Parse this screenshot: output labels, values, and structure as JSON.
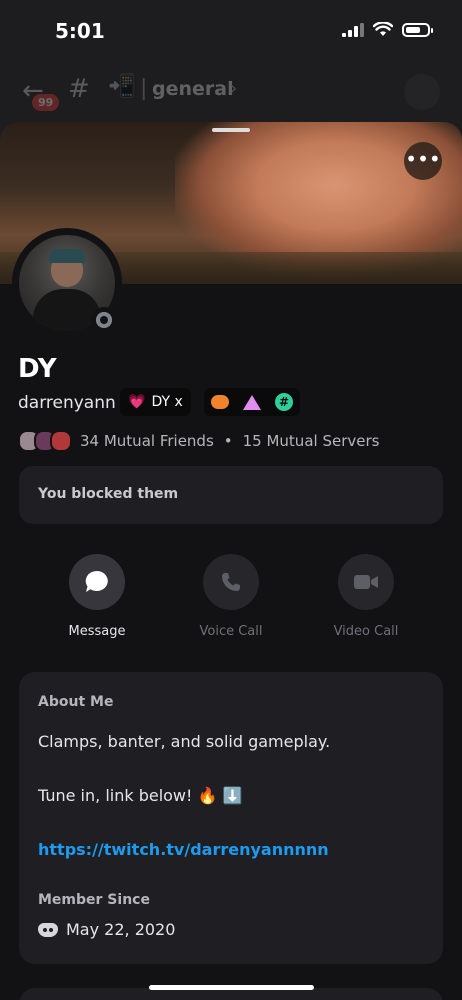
{
  "status_bar": {
    "time": "5:01"
  },
  "channel_header": {
    "unread_badge": "99",
    "channel_emoji": "📲",
    "channel_name": "general"
  },
  "profile": {
    "display_name": "DY",
    "username": "darrenyann",
    "tag_label": "DY x",
    "tag_emoji": "💗",
    "mutual_friends": "34 Mutual Friends",
    "mutual_servers": "15 Mutual Servers",
    "blocked_notice": "You blocked them"
  },
  "actions": [
    {
      "label": "Message",
      "enabled": true
    },
    {
      "label": "Voice Call",
      "enabled": false
    },
    {
      "label": "Video Call",
      "enabled": false
    }
  ],
  "about": {
    "heading": "About Me",
    "line1": "Clamps, banter, and solid gameplay.",
    "line2": "Tune in, link below! 🔥 ⬇️",
    "link": "https://twitch.tv/darrenyannnnn",
    "member_since_heading": "Member Since",
    "member_since": "May 22, 2020"
  },
  "colors": {
    "link": "#1d9bf0",
    "offline_status": "#80848e",
    "badge_orange": "#f0832c",
    "badge_pink": "#e28ef0",
    "badge_green": "#2fcf9b"
  }
}
